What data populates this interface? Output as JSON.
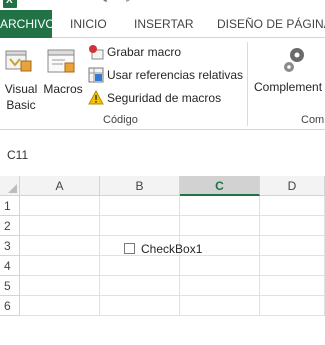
{
  "tabs": {
    "file": "ARCHIVO",
    "items": [
      "INICIO",
      "INSERTAR",
      "DISEÑO DE PÁGINA"
    ]
  },
  "ribbon": {
    "visual_basic": [
      "Visual",
      "Basic"
    ],
    "macros": "Macros",
    "record_macro": "Grabar macro",
    "relative_refs": "Usar referencias relativas",
    "macro_security": "Seguridad de macros",
    "group_code": "Código",
    "addins": "Complement",
    "group_addins": "Com"
  },
  "name_box": {
    "value": "C11"
  },
  "grid": {
    "columns": [
      "A",
      "B",
      "C",
      "D"
    ],
    "selected_column": "C",
    "rows": [
      "1",
      "2",
      "3",
      "4",
      "5",
      "6"
    ]
  },
  "checkbox": {
    "label": "CheckBox1",
    "checked": false
  },
  "colors": {
    "accent": "#217346"
  }
}
